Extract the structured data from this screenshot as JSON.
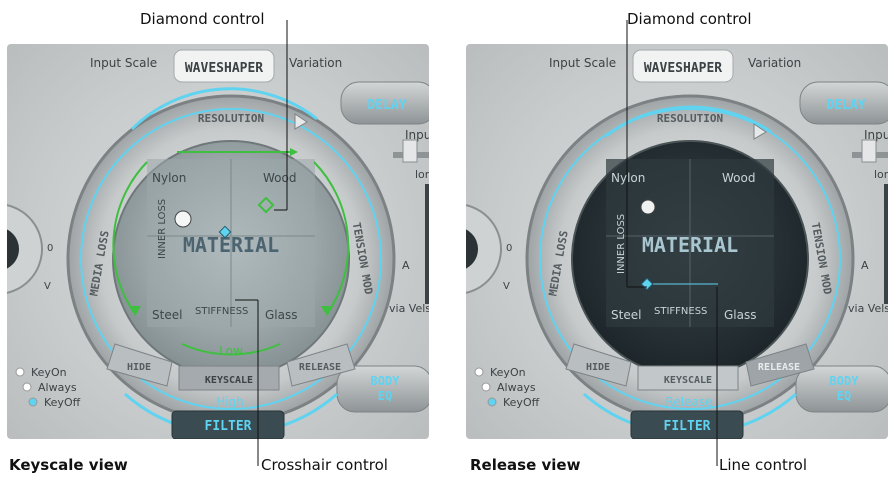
{
  "callouts": {
    "left_top": "Diamond control",
    "right_top": "Diamond control",
    "left_bottom": "Crosshair control",
    "right_bottom": "Line control"
  },
  "captions": {
    "left": "Keyscale view",
    "right": "Release view"
  },
  "left_panel": {
    "input_scale": "Input Scale",
    "waveshaper": "WAVESHAPER",
    "variation": "Variation",
    "delay": "DELAY",
    "input": "Input",
    "long": "long",
    "a": "A",
    "via_vel": "via Velsh",
    "resolution": "RESOLUTION",
    "media_loss": "MEDIA LOSS",
    "tension_mod": "TENSION MOD",
    "corner_nylon": "Nylon",
    "corner_wood": "Wood",
    "corner_steel": "Steel",
    "corner_glass": "Glass",
    "material": "MATERIAL",
    "inner_loss": "INNER LOSS",
    "stiffness": "STIFFNESS",
    "low": "Low",
    "hide": "HIDE",
    "keyscale": "KEYSCALE",
    "release": "RELEASE",
    "high": "High",
    "filter": "FILTER",
    "body_eq_1": "BODY",
    "body_eq_2": "EQ",
    "key_on": "KeyOn",
    "always": "Always",
    "key_off": "KeyOff",
    "v_label": "V",
    "zero": "0"
  },
  "right_panel": {
    "input_scale": "Input Scale",
    "waveshaper": "WAVESHAPER",
    "variation": "Variation",
    "delay": "DELAY",
    "input": "Inpu",
    "long": "lon",
    "a": "A",
    "via_vel": "via Velsh",
    "resolution": "RESOLUTION",
    "media_loss": "MEDIA LOSS",
    "tension_mod": "TENSION MOD",
    "corner_nylon": "Nylon",
    "corner_wood": "Wood",
    "corner_steel": "Steel",
    "corner_glass": "Glass",
    "material": "MATERIAL",
    "inner_loss": "INNER LOSS",
    "stiffness": "STIFFNESS",
    "hide": "HIDE",
    "keyscale": "KEYSCALE",
    "release": "RELEASE",
    "release_bottom": "Release",
    "filter": "FILTER",
    "body_eq_1": "BODY",
    "body_eq_2": "EQ",
    "key_on": "KeyOn",
    "always": "Always",
    "key_off": "KeyOff",
    "v_label": "V",
    "zero": "0"
  },
  "colors": {
    "accent_cyan": "#5fd3f0",
    "accent_green": "#3fbf3f",
    "panel_dark": "#1f272b",
    "text_dark": "#4a4f52"
  }
}
